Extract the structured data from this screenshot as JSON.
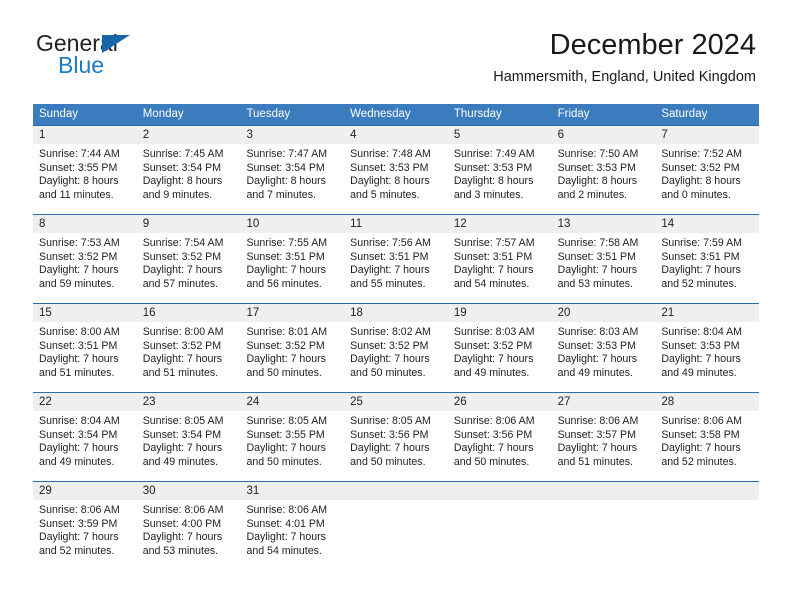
{
  "brand": {
    "name_part1": "General",
    "name_part2": "Blue",
    "triangle_icon": "blue-triangle-icon"
  },
  "header": {
    "title": "December 2024",
    "subtitle": "Hammersmith, England, United Kingdom"
  },
  "colors": {
    "header_blue": "#3a7cbe",
    "week_border_blue": "#2e6ca4",
    "daynum_band": "#efefef",
    "brand_blue": "#1b7bc4",
    "text": "#1f1f1f"
  },
  "weekdays": [
    "Sunday",
    "Monday",
    "Tuesday",
    "Wednesday",
    "Thursday",
    "Friday",
    "Saturday"
  ],
  "weeks": [
    [
      {
        "day": "1",
        "sunrise": "Sunrise: 7:44 AM",
        "sunset": "Sunset: 3:55 PM",
        "daylight1": "Daylight: 8 hours",
        "daylight2": "and 11 minutes."
      },
      {
        "day": "2",
        "sunrise": "Sunrise: 7:45 AM",
        "sunset": "Sunset: 3:54 PM",
        "daylight1": "Daylight: 8 hours",
        "daylight2": "and 9 minutes."
      },
      {
        "day": "3",
        "sunrise": "Sunrise: 7:47 AM",
        "sunset": "Sunset: 3:54 PM",
        "daylight1": "Daylight: 8 hours",
        "daylight2": "and 7 minutes."
      },
      {
        "day": "4",
        "sunrise": "Sunrise: 7:48 AM",
        "sunset": "Sunset: 3:53 PM",
        "daylight1": "Daylight: 8 hours",
        "daylight2": "and 5 minutes."
      },
      {
        "day": "5",
        "sunrise": "Sunrise: 7:49 AM",
        "sunset": "Sunset: 3:53 PM",
        "daylight1": "Daylight: 8 hours",
        "daylight2": "and 3 minutes."
      },
      {
        "day": "6",
        "sunrise": "Sunrise: 7:50 AM",
        "sunset": "Sunset: 3:53 PM",
        "daylight1": "Daylight: 8 hours",
        "daylight2": "and 2 minutes."
      },
      {
        "day": "7",
        "sunrise": "Sunrise: 7:52 AM",
        "sunset": "Sunset: 3:52 PM",
        "daylight1": "Daylight: 8 hours",
        "daylight2": "and 0 minutes."
      }
    ],
    [
      {
        "day": "8",
        "sunrise": "Sunrise: 7:53 AM",
        "sunset": "Sunset: 3:52 PM",
        "daylight1": "Daylight: 7 hours",
        "daylight2": "and 59 minutes."
      },
      {
        "day": "9",
        "sunrise": "Sunrise: 7:54 AM",
        "sunset": "Sunset: 3:52 PM",
        "daylight1": "Daylight: 7 hours",
        "daylight2": "and 57 minutes."
      },
      {
        "day": "10",
        "sunrise": "Sunrise: 7:55 AM",
        "sunset": "Sunset: 3:51 PM",
        "daylight1": "Daylight: 7 hours",
        "daylight2": "and 56 minutes."
      },
      {
        "day": "11",
        "sunrise": "Sunrise: 7:56 AM",
        "sunset": "Sunset: 3:51 PM",
        "daylight1": "Daylight: 7 hours",
        "daylight2": "and 55 minutes."
      },
      {
        "day": "12",
        "sunrise": "Sunrise: 7:57 AM",
        "sunset": "Sunset: 3:51 PM",
        "daylight1": "Daylight: 7 hours",
        "daylight2": "and 54 minutes."
      },
      {
        "day": "13",
        "sunrise": "Sunrise: 7:58 AM",
        "sunset": "Sunset: 3:51 PM",
        "daylight1": "Daylight: 7 hours",
        "daylight2": "and 53 minutes."
      },
      {
        "day": "14",
        "sunrise": "Sunrise: 7:59 AM",
        "sunset": "Sunset: 3:51 PM",
        "daylight1": "Daylight: 7 hours",
        "daylight2": "and 52 minutes."
      }
    ],
    [
      {
        "day": "15",
        "sunrise": "Sunrise: 8:00 AM",
        "sunset": "Sunset: 3:51 PM",
        "daylight1": "Daylight: 7 hours",
        "daylight2": "and 51 minutes."
      },
      {
        "day": "16",
        "sunrise": "Sunrise: 8:00 AM",
        "sunset": "Sunset: 3:52 PM",
        "daylight1": "Daylight: 7 hours",
        "daylight2": "and 51 minutes."
      },
      {
        "day": "17",
        "sunrise": "Sunrise: 8:01 AM",
        "sunset": "Sunset: 3:52 PM",
        "daylight1": "Daylight: 7 hours",
        "daylight2": "and 50 minutes."
      },
      {
        "day": "18",
        "sunrise": "Sunrise: 8:02 AM",
        "sunset": "Sunset: 3:52 PM",
        "daylight1": "Daylight: 7 hours",
        "daylight2": "and 50 minutes."
      },
      {
        "day": "19",
        "sunrise": "Sunrise: 8:03 AM",
        "sunset": "Sunset: 3:52 PM",
        "daylight1": "Daylight: 7 hours",
        "daylight2": "and 49 minutes."
      },
      {
        "day": "20",
        "sunrise": "Sunrise: 8:03 AM",
        "sunset": "Sunset: 3:53 PM",
        "daylight1": "Daylight: 7 hours",
        "daylight2": "and 49 minutes."
      },
      {
        "day": "21",
        "sunrise": "Sunrise: 8:04 AM",
        "sunset": "Sunset: 3:53 PM",
        "daylight1": "Daylight: 7 hours",
        "daylight2": "and 49 minutes."
      }
    ],
    [
      {
        "day": "22",
        "sunrise": "Sunrise: 8:04 AM",
        "sunset": "Sunset: 3:54 PM",
        "daylight1": "Daylight: 7 hours",
        "daylight2": "and 49 minutes."
      },
      {
        "day": "23",
        "sunrise": "Sunrise: 8:05 AM",
        "sunset": "Sunset: 3:54 PM",
        "daylight1": "Daylight: 7 hours",
        "daylight2": "and 49 minutes."
      },
      {
        "day": "24",
        "sunrise": "Sunrise: 8:05 AM",
        "sunset": "Sunset: 3:55 PM",
        "daylight1": "Daylight: 7 hours",
        "daylight2": "and 50 minutes."
      },
      {
        "day": "25",
        "sunrise": "Sunrise: 8:05 AM",
        "sunset": "Sunset: 3:56 PM",
        "daylight1": "Daylight: 7 hours",
        "daylight2": "and 50 minutes."
      },
      {
        "day": "26",
        "sunrise": "Sunrise: 8:06 AM",
        "sunset": "Sunset: 3:56 PM",
        "daylight1": "Daylight: 7 hours",
        "daylight2": "and 50 minutes."
      },
      {
        "day": "27",
        "sunrise": "Sunrise: 8:06 AM",
        "sunset": "Sunset: 3:57 PM",
        "daylight1": "Daylight: 7 hours",
        "daylight2": "and 51 minutes."
      },
      {
        "day": "28",
        "sunrise": "Sunrise: 8:06 AM",
        "sunset": "Sunset: 3:58 PM",
        "daylight1": "Daylight: 7 hours",
        "daylight2": "and 52 minutes."
      }
    ],
    [
      {
        "day": "29",
        "sunrise": "Sunrise: 8:06 AM",
        "sunset": "Sunset: 3:59 PM",
        "daylight1": "Daylight: 7 hours",
        "daylight2": "and 52 minutes."
      },
      {
        "day": "30",
        "sunrise": "Sunrise: 8:06 AM",
        "sunset": "Sunset: 4:00 PM",
        "daylight1": "Daylight: 7 hours",
        "daylight2": "and 53 minutes."
      },
      {
        "day": "31",
        "sunrise": "Sunrise: 8:06 AM",
        "sunset": "Sunset: 4:01 PM",
        "daylight1": "Daylight: 7 hours",
        "daylight2": "and 54 minutes."
      },
      {
        "day": "",
        "sunrise": "",
        "sunset": "",
        "daylight1": "",
        "daylight2": ""
      },
      {
        "day": "",
        "sunrise": "",
        "sunset": "",
        "daylight1": "",
        "daylight2": ""
      },
      {
        "day": "",
        "sunrise": "",
        "sunset": "",
        "daylight1": "",
        "daylight2": ""
      },
      {
        "day": "",
        "sunrise": "",
        "sunset": "",
        "daylight1": "",
        "daylight2": ""
      }
    ]
  ]
}
